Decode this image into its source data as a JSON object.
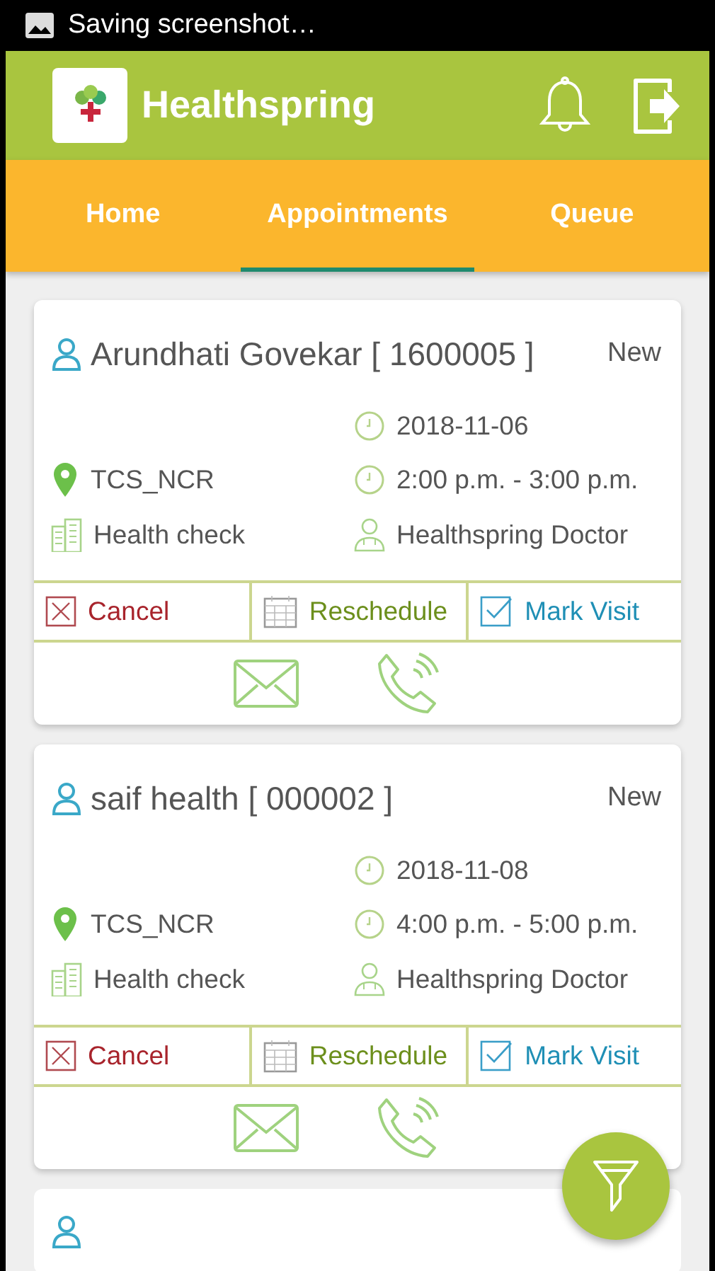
{
  "status_bar": {
    "notification": "Saving screenshot…"
  },
  "header": {
    "title": "Healthspring"
  },
  "tabs": [
    {
      "label": "Home",
      "selected": false
    },
    {
      "label": "Appointments",
      "selected": true
    },
    {
      "label": "Queue",
      "selected": false
    }
  ],
  "appointments": [
    {
      "patient": "Arundhati Govekar [ 1600005 ]",
      "status": "New",
      "date": "2018-11-06",
      "location": "TCS_NCR",
      "time": "2:00 p.m. - 3:00 p.m.",
      "service": "Health check",
      "doctor": "Healthspring Doctor",
      "actions": [
        {
          "kind": "cancel",
          "label": "Cancel"
        },
        {
          "kind": "reschedule",
          "label": "Reschedule"
        },
        {
          "kind": "mark",
          "label": "Mark Visit"
        }
      ]
    },
    {
      "patient": "saif health [ 000002 ]",
      "status": "New",
      "date": "2018-11-08",
      "location": "TCS_NCR",
      "time": "4:00 p.m. - 5:00 p.m.",
      "service": "Health check",
      "doctor": "Healthspring Doctor",
      "actions": [
        {
          "kind": "cancel",
          "label": "Cancel"
        },
        {
          "kind": "reschedule",
          "label": "Reschedule"
        },
        {
          "kind": "mark",
          "label": "Mark Visit"
        }
      ]
    }
  ]
}
